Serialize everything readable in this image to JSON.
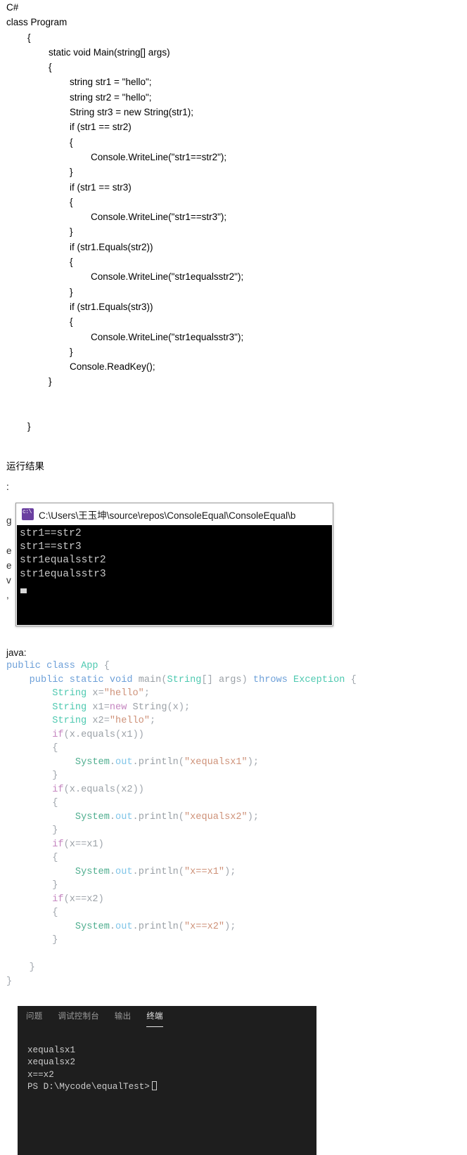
{
  "csharp": {
    "language_label": "C#",
    "lines": [
      "C#",
      "class Program",
      "        {",
      "                static void Main(string[] args)",
      "                {",
      "                        string str1 = \"hello\";",
      "                        string str2 = \"hello\";",
      "                        String str3 = new String(str1);",
      "                        if (str1 == str2)",
      "                        {",
      "                                Console.WriteLine(\"str1==str2\");",
      "                        }",
      "                        if (str1 == str3)",
      "                        {",
      "                                Console.WriteLine(\"str1==str3\");",
      "                        }",
      "                        if (str1.Equals(str2))",
      "                        {",
      "                                Console.WriteLine(\"str1equalsstr2\");",
      "                        }",
      "                        if (str1.Equals(str3))",
      "                        {",
      "                                Console.WriteLine(\"str1equalsstr3\");",
      "                        }",
      "                        Console.ReadKey();",
      "                }",
      "",
      "",
      "        }"
    ]
  },
  "run_result": {
    "heading": "运行结果",
    "colon": ":"
  },
  "background_text": {
    "lines": [
      "g",
      "",
      "e",
      "e",
      "v",
      ","
    ]
  },
  "console_window": {
    "icon": "console-app-icon",
    "title": "C:\\Users\\王玉坤\\source\\repos\\ConsoleEqual\\ConsoleEqual\\b",
    "output_lines": [
      "str1==str2",
      "str1==str3",
      "str1equalsstr2",
      "str1equalsstr3"
    ]
  },
  "java": {
    "label": "java:",
    "lines": [
      [
        {
          "t": "public",
          "c": "j-blue"
        },
        {
          "t": " ",
          "c": "j-punct"
        },
        {
          "t": "class",
          "c": "j-blue"
        },
        {
          "t": " ",
          "c": "j-punct"
        },
        {
          "t": "App",
          "c": "j-teal"
        },
        {
          "t": " {",
          "c": "j-punct"
        }
      ],
      [
        {
          "t": "    ",
          "c": "j-punct"
        },
        {
          "t": "public",
          "c": "j-blue"
        },
        {
          "t": " ",
          "c": "j-punct"
        },
        {
          "t": "static",
          "c": "j-blue"
        },
        {
          "t": " ",
          "c": "j-punct"
        },
        {
          "t": "void",
          "c": "j-blue"
        },
        {
          "t": " ",
          "c": "j-punct"
        },
        {
          "t": "main",
          "c": "j-gray"
        },
        {
          "t": "(",
          "c": "j-punct"
        },
        {
          "t": "String",
          "c": "j-teal"
        },
        {
          "t": "[] ",
          "c": "j-punct"
        },
        {
          "t": "args",
          "c": "j-gray"
        },
        {
          "t": ") ",
          "c": "j-punct"
        },
        {
          "t": "throws",
          "c": "j-blue"
        },
        {
          "t": " ",
          "c": "j-punct"
        },
        {
          "t": "Exception",
          "c": "j-teal"
        },
        {
          "t": " {",
          "c": "j-punct"
        }
      ],
      [
        {
          "t": "        ",
          "c": "j-punct"
        },
        {
          "t": "String",
          "c": "j-teal"
        },
        {
          "t": " ",
          "c": "j-punct"
        },
        {
          "t": "x",
          "c": "j-gray"
        },
        {
          "t": "=",
          "c": "j-punct"
        },
        {
          "t": "\"hello\"",
          "c": "j-orange"
        },
        {
          "t": ";",
          "c": "j-punct"
        }
      ],
      [
        {
          "t": "        ",
          "c": "j-punct"
        },
        {
          "t": "String",
          "c": "j-teal"
        },
        {
          "t": " ",
          "c": "j-punct"
        },
        {
          "t": "x1",
          "c": "j-gray"
        },
        {
          "t": "=",
          "c": "j-punct"
        },
        {
          "t": "new",
          "c": "j-purple"
        },
        {
          "t": " ",
          "c": "j-punct"
        },
        {
          "t": "String",
          "c": "j-gray"
        },
        {
          "t": "(",
          "c": "j-punct"
        },
        {
          "t": "x",
          "c": "j-gray"
        },
        {
          "t": ");",
          "c": "j-punct"
        }
      ],
      [
        {
          "t": "        ",
          "c": "j-punct"
        },
        {
          "t": "String",
          "c": "j-teal"
        },
        {
          "t": " ",
          "c": "j-punct"
        },
        {
          "t": "x2",
          "c": "j-gray"
        },
        {
          "t": "=",
          "c": "j-punct"
        },
        {
          "t": "\"hello\"",
          "c": "j-orange"
        },
        {
          "t": ";",
          "c": "j-punct"
        }
      ],
      [
        {
          "t": "        ",
          "c": "j-punct"
        },
        {
          "t": "if",
          "c": "j-purple"
        },
        {
          "t": "(",
          "c": "j-punct"
        },
        {
          "t": "x",
          "c": "j-gray"
        },
        {
          "t": ".",
          "c": "j-punct"
        },
        {
          "t": "equals",
          "c": "j-gray"
        },
        {
          "t": "(",
          "c": "j-punct"
        },
        {
          "t": "x1",
          "c": "j-gray"
        },
        {
          "t": "))",
          "c": "j-punct"
        }
      ],
      [
        {
          "t": "        {",
          "c": "j-punct"
        }
      ],
      [
        {
          "t": "            ",
          "c": "j-punct"
        },
        {
          "t": "System",
          "c": "j-green"
        },
        {
          "t": ".",
          "c": "j-punct"
        },
        {
          "t": "out",
          "c": "j-lightblue"
        },
        {
          "t": ".",
          "c": "j-punct"
        },
        {
          "t": "println",
          "c": "j-gray"
        },
        {
          "t": "(",
          "c": "j-punct"
        },
        {
          "t": "\"xequalsx1\"",
          "c": "j-orange"
        },
        {
          "t": ");",
          "c": "j-punct"
        }
      ],
      [
        {
          "t": "        }",
          "c": "j-punct"
        }
      ],
      [
        {
          "t": "        ",
          "c": "j-punct"
        },
        {
          "t": "if",
          "c": "j-purple"
        },
        {
          "t": "(",
          "c": "j-punct"
        },
        {
          "t": "x",
          "c": "j-gray"
        },
        {
          "t": ".",
          "c": "j-punct"
        },
        {
          "t": "equals",
          "c": "j-gray"
        },
        {
          "t": "(",
          "c": "j-punct"
        },
        {
          "t": "x2",
          "c": "j-gray"
        },
        {
          "t": "))",
          "c": "j-punct"
        }
      ],
      [
        {
          "t": "        {",
          "c": "j-punct"
        }
      ],
      [
        {
          "t": "            ",
          "c": "j-punct"
        },
        {
          "t": "System",
          "c": "j-green"
        },
        {
          "t": ".",
          "c": "j-punct"
        },
        {
          "t": "out",
          "c": "j-lightblue"
        },
        {
          "t": ".",
          "c": "j-punct"
        },
        {
          "t": "println",
          "c": "j-gray"
        },
        {
          "t": "(",
          "c": "j-punct"
        },
        {
          "t": "\"xequalsx2\"",
          "c": "j-orange"
        },
        {
          "t": ");",
          "c": "j-punct"
        }
      ],
      [
        {
          "t": "        }",
          "c": "j-punct"
        }
      ],
      [
        {
          "t": "        ",
          "c": "j-punct"
        },
        {
          "t": "if",
          "c": "j-purple"
        },
        {
          "t": "(",
          "c": "j-punct"
        },
        {
          "t": "x",
          "c": "j-gray"
        },
        {
          "t": "==",
          "c": "j-punct"
        },
        {
          "t": "x1",
          "c": "j-gray"
        },
        {
          "t": ")",
          "c": "j-punct"
        }
      ],
      [
        {
          "t": "        {",
          "c": "j-punct"
        }
      ],
      [
        {
          "t": "            ",
          "c": "j-punct"
        },
        {
          "t": "System",
          "c": "j-green"
        },
        {
          "t": ".",
          "c": "j-punct"
        },
        {
          "t": "out",
          "c": "j-lightblue"
        },
        {
          "t": ".",
          "c": "j-punct"
        },
        {
          "t": "println",
          "c": "j-gray"
        },
        {
          "t": "(",
          "c": "j-punct"
        },
        {
          "t": "\"x==x1\"",
          "c": "j-orange"
        },
        {
          "t": ");",
          "c": "j-punct"
        }
      ],
      [
        {
          "t": "        }",
          "c": "j-punct"
        }
      ],
      [
        {
          "t": "        ",
          "c": "j-punct"
        },
        {
          "t": "if",
          "c": "j-purple"
        },
        {
          "t": "(",
          "c": "j-punct"
        },
        {
          "t": "x",
          "c": "j-gray"
        },
        {
          "t": "==",
          "c": "j-punct"
        },
        {
          "t": "x2",
          "c": "j-gray"
        },
        {
          "t": ")",
          "c": "j-punct"
        }
      ],
      [
        {
          "t": "        {",
          "c": "j-punct"
        }
      ],
      [
        {
          "t": "            ",
          "c": "j-punct"
        },
        {
          "t": "System",
          "c": "j-green"
        },
        {
          "t": ".",
          "c": "j-punct"
        },
        {
          "t": "out",
          "c": "j-lightblue"
        },
        {
          "t": ".",
          "c": "j-punct"
        },
        {
          "t": "println",
          "c": "j-gray"
        },
        {
          "t": "(",
          "c": "j-punct"
        },
        {
          "t": "\"x==x2\"",
          "c": "j-orange"
        },
        {
          "t": ");",
          "c": "j-punct"
        }
      ],
      [
        {
          "t": "        }",
          "c": "j-punct"
        }
      ],
      [
        {
          "t": "",
          "c": "j-punct"
        }
      ],
      [
        {
          "t": "    }",
          "c": "j-punct"
        }
      ],
      [
        {
          "t": "}",
          "c": "j-punct"
        }
      ]
    ]
  },
  "terminal": {
    "tabs": [
      {
        "label": "问题",
        "active": false
      },
      {
        "label": "调试控制台",
        "active": false
      },
      {
        "label": "输出",
        "active": false
      },
      {
        "label": "终端",
        "active": true
      }
    ],
    "output_lines": [
      "xequalsx1",
      "xequalsx2",
      "x==x2"
    ],
    "prompt": "PS D:\\Mycode\\equalTest>"
  }
}
